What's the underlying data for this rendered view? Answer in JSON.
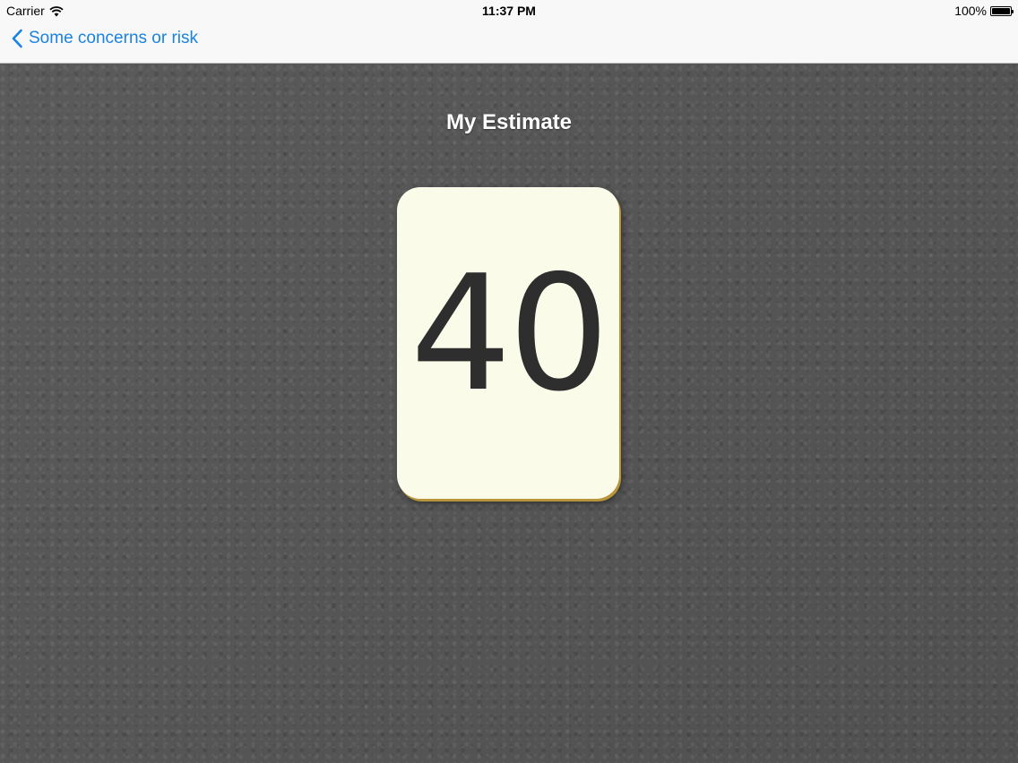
{
  "status_bar": {
    "carrier": "Carrier",
    "time": "11:37 PM",
    "battery_percent": "100%",
    "battery_level": 1.0
  },
  "nav": {
    "back_label": "Some concerns or risk",
    "accent_color": "#1a82e2"
  },
  "main": {
    "title": "My Estimate",
    "card_value": "40"
  },
  "colors": {
    "card_background": "#fafbe9",
    "background": "#555555"
  },
  "icons": [
    "wifi-icon",
    "battery-icon",
    "chevron-left-icon"
  ]
}
